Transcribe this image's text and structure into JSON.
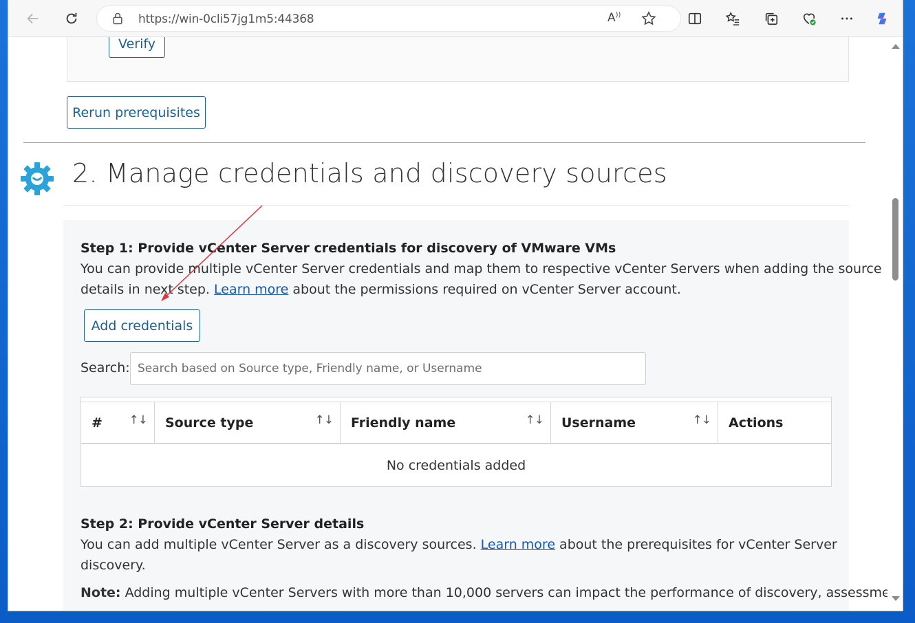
{
  "browser": {
    "url": "https://win-0cli57jg1m5:44368",
    "read_aloud_glyph": "Ă̵",
    "icons": [
      "back-icon",
      "refresh-icon",
      "lock-icon",
      "read-aloud-icon",
      "favorite-star-icon",
      "split-screen-icon",
      "favorites-icon",
      "collections-icon",
      "browser-essentials-icon",
      "more-icon",
      "copilot-icon"
    ]
  },
  "page": {
    "verify_label": "Verify",
    "rerun_label": "Rerun prerequisites",
    "section_title": "2. Manage credentials and discovery sources",
    "step1": {
      "title": "Step 1: Provide vCenter Server credentials for discovery of VMware VMs",
      "line1": "You can provide multiple vCenter Server credentials and map them to respective vCenter Servers when adding the source",
      "line2_pre": "details in next step. ",
      "link": "Learn more",
      "line2_post": " about the permissions required on vCenter Server account.",
      "add_button": "Add credentials"
    },
    "search": {
      "label": "Search:",
      "placeholder": "Search based on Source type, Friendly name, or Username"
    },
    "table": {
      "columns": [
        "#",
        "Source type",
        "Friendly name",
        "Username",
        "Actions"
      ],
      "sort_glyph": "↑↓",
      "empty_message": "No credentials added"
    },
    "step2": {
      "title": "Step 2: Provide vCenter Server details",
      "line1_pre": "You can add multiple vCenter Server as a discovery sources. ",
      "link": "Learn more",
      "line1_post": " about the prerequisites for vCenter Server",
      "line2": "discovery.",
      "note_label": "Note:",
      "note_text": " Adding multiple vCenter Servers with more than 10,000 servers can impact the performance of discovery, assessment"
    }
  },
  "colors": {
    "accent": "#1f5f8f",
    "link": "#1558b8",
    "icon_blue": "#2aa3d8",
    "annotation_arrow": "#d9363e"
  }
}
